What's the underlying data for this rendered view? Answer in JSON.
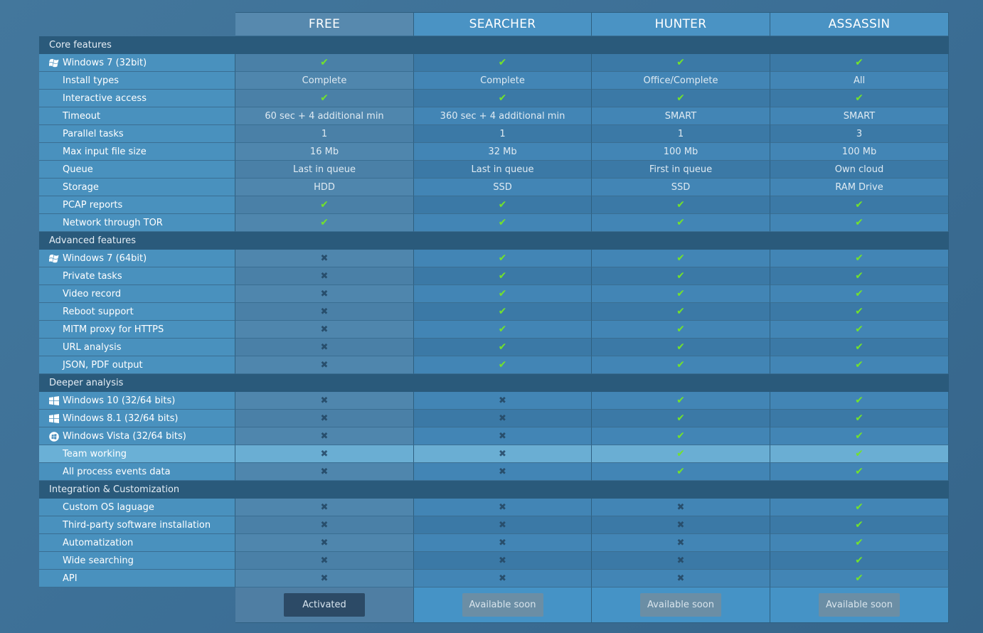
{
  "plans": [
    "FREE",
    "SEARCHER",
    "HUNTER",
    "ASSASSIN"
  ],
  "sections": [
    {
      "title": "Core features",
      "rows": [
        {
          "label": "Windows 7 (32bit)",
          "icon": "windows-7-icon",
          "values": [
            "check",
            "check",
            "check",
            "check"
          ]
        },
        {
          "label": "Install types",
          "values": [
            "Complete",
            "Complete",
            "Office/Complete",
            "All"
          ]
        },
        {
          "label": "Interactive access",
          "values": [
            "check",
            "check",
            "check",
            "check"
          ]
        },
        {
          "label": "Timeout",
          "values": [
            "60 sec + 4 additional min",
            "360 sec + 4 additional min",
            "SMART",
            "SMART"
          ]
        },
        {
          "label": "Parallel tasks",
          "values": [
            "1",
            "1",
            "1",
            "3"
          ]
        },
        {
          "label": "Max input file size",
          "values": [
            "16 Mb",
            "32 Mb",
            "100 Mb",
            "100 Mb"
          ]
        },
        {
          "label": "Queue",
          "values": [
            "Last in queue",
            "Last in queue",
            "First in queue",
            "Own cloud"
          ]
        },
        {
          "label": "Storage",
          "values": [
            "HDD",
            "SSD",
            "SSD",
            "RAM Drive"
          ]
        },
        {
          "label": "PCAP reports",
          "values": [
            "check",
            "check",
            "check",
            "check"
          ]
        },
        {
          "label": "Network through TOR",
          "values": [
            "check",
            "check",
            "check",
            "check"
          ]
        }
      ]
    },
    {
      "title": "Advanced features",
      "rows": [
        {
          "label": "Windows 7 (64bit)",
          "icon": "windows-7-icon",
          "values": [
            "cross",
            "check",
            "check",
            "check"
          ]
        },
        {
          "label": "Private tasks",
          "values": [
            "cross",
            "check",
            "check",
            "check"
          ]
        },
        {
          "label": "Video record",
          "values": [
            "cross",
            "check",
            "check",
            "check"
          ]
        },
        {
          "label": "Reboot support",
          "values": [
            "cross",
            "check",
            "check",
            "check"
          ]
        },
        {
          "label": "MITM proxy for HTTPS",
          "values": [
            "cross",
            "check",
            "check",
            "check"
          ]
        },
        {
          "label": "URL analysis",
          "values": [
            "cross",
            "check",
            "check",
            "check"
          ]
        },
        {
          "label": "JSON, PDF output",
          "values": [
            "cross",
            "check",
            "check",
            "check"
          ]
        }
      ]
    },
    {
      "title": "Deeper analysis",
      "rows": [
        {
          "label": "Windows 10 (32/64 bits)",
          "icon": "windows-10-icon",
          "values": [
            "cross",
            "cross",
            "check",
            "check"
          ]
        },
        {
          "label": "Windows 8.1 (32/64 bits)",
          "icon": "windows-10-icon",
          "values": [
            "cross",
            "cross",
            "check",
            "check"
          ]
        },
        {
          "label": "Windows Vista (32/64 bits)",
          "icon": "windows-vista-icon",
          "values": [
            "cross",
            "cross",
            "check",
            "check"
          ]
        },
        {
          "label": "Team working",
          "highlight": true,
          "values": [
            "cross",
            "cross",
            "check",
            "check"
          ]
        },
        {
          "label": "All process events data",
          "values": [
            "cross",
            "cross",
            "check",
            "check"
          ]
        }
      ]
    },
    {
      "title": "Integration & Customization",
      "rows": [
        {
          "label": "Custom OS laguage",
          "values": [
            "cross",
            "cross",
            "cross",
            "check"
          ]
        },
        {
          "label": "Third-party software installation",
          "values": [
            "cross",
            "cross",
            "cross",
            "check"
          ]
        },
        {
          "label": "Automatization",
          "values": [
            "cross",
            "cross",
            "cross",
            "check"
          ]
        },
        {
          "label": "Wide searching",
          "values": [
            "cross",
            "cross",
            "cross",
            "check"
          ]
        },
        {
          "label": "API",
          "values": [
            "cross",
            "cross",
            "cross",
            "check"
          ]
        }
      ]
    }
  ],
  "buttons": [
    {
      "label": "Activated",
      "state": "active"
    },
    {
      "label": "Available soon",
      "state": "soon"
    },
    {
      "label": "Available soon",
      "state": "soon"
    },
    {
      "label": "Available soon",
      "state": "soon"
    }
  ],
  "colors": {
    "check": "#73e22b",
    "cross": "#284e6c",
    "section": "#2a5a7b"
  }
}
